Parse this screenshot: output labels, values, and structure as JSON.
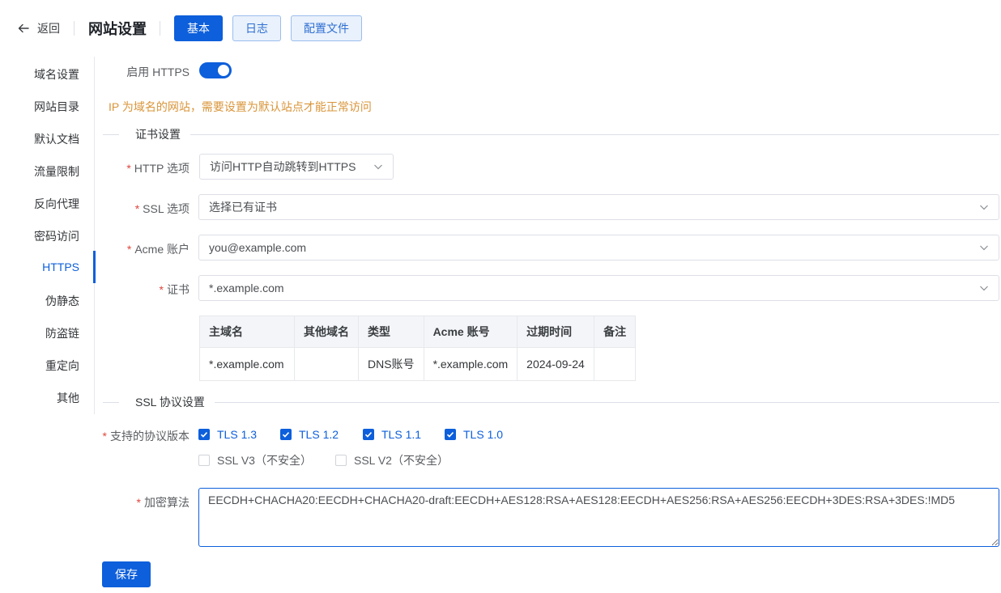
{
  "header": {
    "back_label": "返回",
    "title": "网站设置",
    "tabs": [
      {
        "label": "基本",
        "active": true
      },
      {
        "label": "日志",
        "active": false
      },
      {
        "label": "配置文件",
        "active": false
      }
    ]
  },
  "menu": {
    "items": [
      {
        "label": "域名设置"
      },
      {
        "label": "网站目录"
      },
      {
        "label": "默认文档"
      },
      {
        "label": "流量限制"
      },
      {
        "label": "反向代理"
      },
      {
        "label": "密码访问"
      },
      {
        "label": "HTTPS",
        "active": true
      },
      {
        "label": "伪静态"
      },
      {
        "label": "防盗链"
      },
      {
        "label": "重定向"
      },
      {
        "label": "其他"
      }
    ]
  },
  "form": {
    "enable_https_label": "启用 HTTPS",
    "enable_https": true,
    "warning": "IP 为域名的网站，需要设置为默认站点才能正常访问",
    "cert_section_title": "证书设置",
    "http_option_label": "HTTP 选项",
    "http_option_value": "访问HTTP自动跳转到HTTPS",
    "ssl_option_label": "SSL 选项",
    "ssl_option_value": "选择已有证书",
    "acme_account_label": "Acme 账户",
    "acme_account_value": "you@example.com",
    "cert_label": "证书",
    "cert_value": "*.example.com",
    "cert_table": {
      "headers": [
        "主域名",
        "其他域名",
        "类型",
        "Acme 账号",
        "过期时间",
        "备注"
      ],
      "rows": [
        [
          "*.example.com",
          "",
          "DNS账号",
          "*.example.com",
          "2024-09-24",
          ""
        ]
      ]
    },
    "ssl_section_title": "SSL 协议设置",
    "protocols_label": "支持的协议版本",
    "protocols": [
      {
        "label": "TLS 1.3",
        "checked": true
      },
      {
        "label": "TLS 1.2",
        "checked": true
      },
      {
        "label": "TLS 1.1",
        "checked": true
      },
      {
        "label": "TLS 1.0",
        "checked": true
      },
      {
        "label": "SSL V3（不安全）",
        "checked": false
      },
      {
        "label": "SSL V2（不安全）",
        "checked": false
      }
    ],
    "cipher_label": "加密算法",
    "cipher_value": "EECDH+CHACHA20:EECDH+CHACHA20-draft:EECDH+AES128:RSA+AES128:EECDH+AES256:RSA+AES256:EECDH+3DES:RSA+3DES:!MD5",
    "required_mark": "*",
    "save_label": "保存"
  },
  "colors": {
    "primary": "#0d5fdb",
    "warning": "#d9953a",
    "required": "#e0463c"
  }
}
